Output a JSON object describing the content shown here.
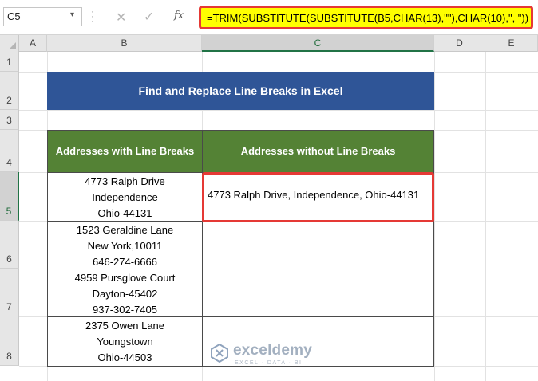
{
  "formula_bar": {
    "name_box": "C5",
    "fx_label": "fx",
    "formula": "=TRIM(SUBSTITUTE(SUBSTITUTE(B5,CHAR(13),\"\"),CHAR(10),\", \"))"
  },
  "columns": [
    "A",
    "B",
    "C",
    "D",
    "E"
  ],
  "rows": [
    "1",
    "2",
    "3",
    "4",
    "5",
    "6",
    "7",
    "8"
  ],
  "title": "Find and Replace Line Breaks in Excel",
  "table": {
    "headers": [
      "Addresses with Line Breaks",
      "Addresses without Line Breaks"
    ],
    "rows": [
      {
        "lines": [
          "4773 Ralph Drive",
          "Independence",
          "Ohio-44131"
        ],
        "result": "4773 Ralph Drive, Independence, Ohio-44131"
      },
      {
        "lines": [
          "1523 Geraldine Lane",
          "New York,10011",
          "646-274-6666"
        ],
        "result": ""
      },
      {
        "lines": [
          "4959 Pursglove Court",
          "Dayton-45402",
          "937-302-7405"
        ],
        "result": ""
      },
      {
        "lines": [
          "2375 Owen Lane",
          "Youngstown",
          "Ohio-44503"
        ],
        "result": ""
      }
    ]
  },
  "selected_cell": "C5",
  "colors": {
    "title_bg": "#2f5597",
    "header_bg": "#548235",
    "formula_highlight": "#ffff00",
    "highlight_border": "#e53935"
  },
  "watermark": {
    "name": "exceldemy",
    "tagline": "EXCEL · DATA · BI"
  }
}
